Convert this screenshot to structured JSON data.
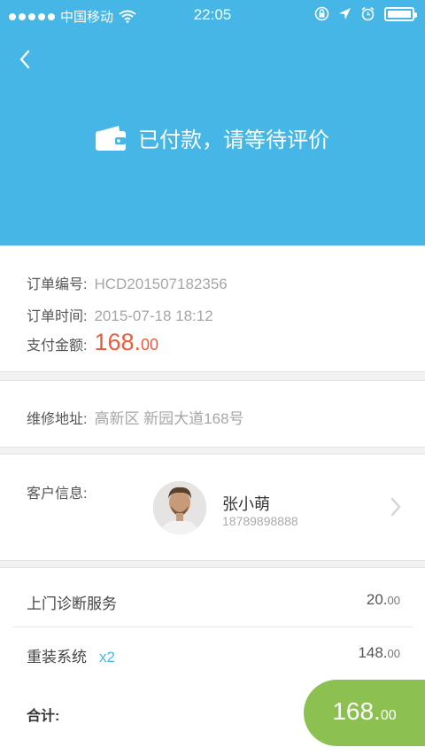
{
  "statusbar": {
    "carrier": "中国移动",
    "time": "22:05"
  },
  "header": {
    "status_text": "已付款，请等待评价"
  },
  "order": {
    "number_label": "订单编号:",
    "number_value": "HCD201507182356",
    "time_label": "订单时间:",
    "time_value": "2015-07-18 18:12",
    "amount_label": "支付金额:",
    "amount_int": "168.",
    "amount_dec": "00"
  },
  "address": {
    "label": "维修地址:",
    "value": "高新区 新园大道168号"
  },
  "customer": {
    "label": "客户信息:",
    "name": "张小萌",
    "phone": "18789898888"
  },
  "items": [
    {
      "name": "上门诊断服务",
      "qty": "",
      "price_int": "20.",
      "price_dec": "00"
    },
    {
      "name": "重装系统",
      "qty": "x2",
      "price_int": "148.",
      "price_dec": "00"
    }
  ],
  "total": {
    "label": "合计:",
    "int": "168.",
    "dec": "00"
  },
  "colors": {
    "header_bg": "#45b6e5",
    "amount": "#ef5a3a",
    "total_pill": "#8cc152"
  }
}
